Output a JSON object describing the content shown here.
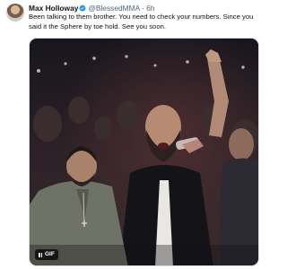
{
  "tweet": {
    "author_name": "Max Holloway",
    "handle": "@BlessedMMA",
    "separator": "·",
    "time": "6h",
    "text": "Been talking to them brother. You need to check your numbers. Since you said it the Sphere by toe hold. See you soon.",
    "media": {
      "badge_label": "GIF",
      "badge_icon": "pause-icon"
    }
  },
  "colors": {
    "verified_blue": "#1d9bf0",
    "name_text": "#0f1419",
    "secondary_text": "#536471",
    "media_border": "#cfd9de"
  }
}
